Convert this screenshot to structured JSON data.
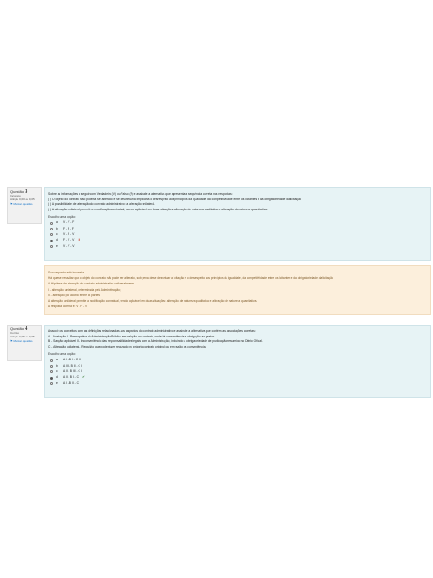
{
  "q3": {
    "info": {
      "label": "Questão",
      "number": "3",
      "state": "Incorreto",
      "mark": "Atingiu 0,00 de 0,05",
      "flag": "Marcar questão"
    },
    "stem": "Sobre as informações a seguir com Verdadeiro (V) ou Falso (F) e assinale a alternativa que apresenta a sequência correta nas respostas:",
    "statements": [
      "( ) O objeto do contrato não poderia ser alterado e se desvirtuaria implicaria o desrespeito aos princípios da igualdade, da competitividade entre os licitantes e da obrigatoriedade da licitação",
      "( ) A possibilidade de alteração do contrato administrativo: a alteração unilateral.",
      "( ) A alteração unilateral permite a modificação contratual, sendo aplicável em duas situações: alteração de natureza qualitativa e alteração de natureza quantitativa."
    ],
    "choose_label": "Escolha uma opção:",
    "options": [
      {
        "letter": "a.",
        "text": "V - V - F",
        "checked": false,
        "mark": ""
      },
      {
        "letter": "b.",
        "text": "F - F - F",
        "checked": false,
        "mark": ""
      },
      {
        "letter": "c.",
        "text": "V - F - V",
        "checked": false,
        "mark": ""
      },
      {
        "letter": "d.",
        "text": "F - V - V",
        "checked": true,
        "mark": "✖"
      },
      {
        "letter": "e.",
        "text": "V - V - V",
        "checked": false,
        "mark": ""
      }
    ]
  },
  "q3_feedback": {
    "lines": [
      "Sua resposta está incorreta.",
      "Há que se ressaltar que o objeto do contrato não pode ser alterado, sob pena de se desvirtuar a licitação e o desrespeito aos princípios da igualdade, da competitividade entre os licitantes e da obrigatoriedade da licitação",
      "A Hipótese de alteração do contrato administrativo unilateralmente",
      "I - alteração unilateral, determinada pela Administração;",
      "II - alteração por acordo entre as partes.",
      "A alteração unilateral permite a modificação contratual, sendo aplicável em duas situações: alteração de natureza qualitativa e alteração de natureza quantitativa.",
      "A resposta correta é: V - F - V"
    ]
  },
  "q4": {
    "info": {
      "label": "Questão",
      "number": "4",
      "state": "Correto",
      "mark": "Atingiu 0,05 de 0,05",
      "flag": "Marcar questão"
    },
    "stem": "Associe os conceitos com as definições relacionadas aos aspectos do contrato administrativo e assinale a alternativa que contém as associações corretas:",
    "statements": [
      "A - Aceitação      I - Prerrogativa da Administração Pública em relação ao contrato, onde há conveniência e obrigação ao gestor.",
      "B - Sanção aplicável      II - Inconveniência das responsabilidades legais com a Administração, incluindo a obrigatoriedade de publicação resumida no Diário Oficial.",
      "C - Alteração unilateral - Requisito que poderá ser realizado no próprio contrato original ou em razão da conveniência."
    ],
    "choose_label": "Escolha uma opção:",
    "options": [
      {
        "letter": "a.",
        "text": "A I - B I - C III",
        "checked": false,
        "mark": ""
      },
      {
        "letter": "b.",
        "text": "A III - B II - C I",
        "checked": false,
        "mark": ""
      },
      {
        "letter": "c.",
        "text": "A II - B III - C I",
        "checked": false,
        "mark": ""
      },
      {
        "letter": "d.",
        "text": "A II - B I - C",
        "checked": true,
        "mark": "✔"
      },
      {
        "letter": "e.",
        "text": "A I - B II - C",
        "checked": false,
        "mark": ""
      }
    ]
  }
}
